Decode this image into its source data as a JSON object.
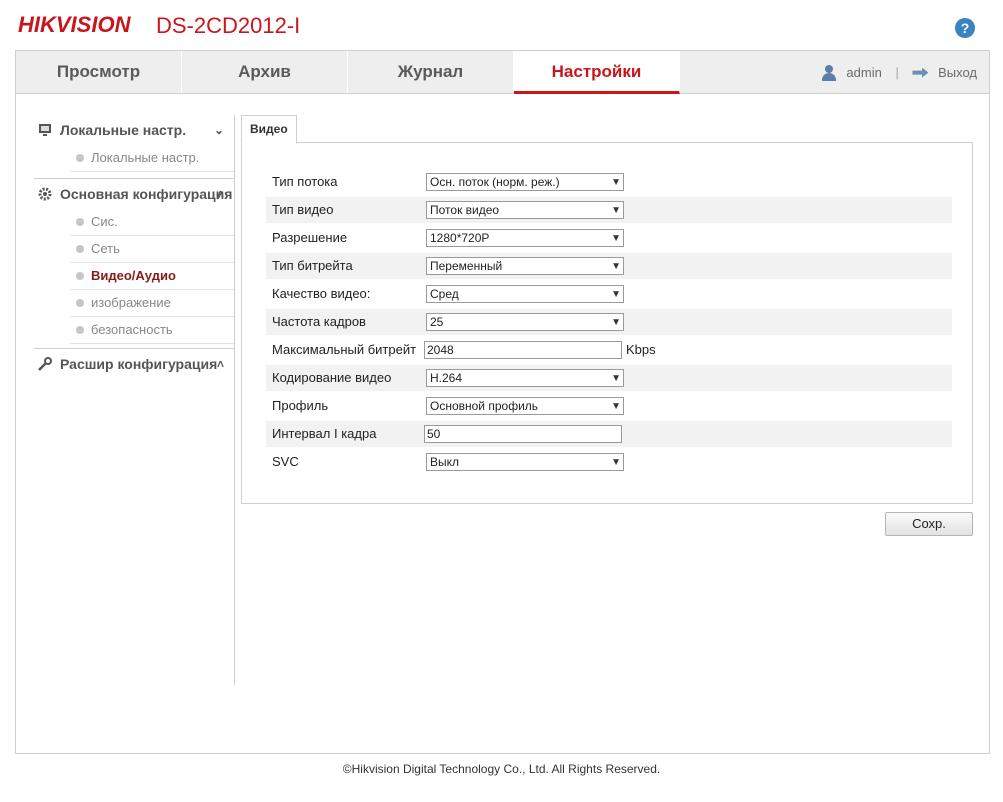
{
  "header": {
    "logo": "HIKVISION",
    "model": "DS-2CD2012-I",
    "help_symbol": "?"
  },
  "nav": {
    "tabs": [
      {
        "label": "Просмотр"
      },
      {
        "label": "Архив"
      },
      {
        "label": "Журнал"
      },
      {
        "label": "Настройки",
        "active": true
      }
    ],
    "user": "admin",
    "separator": "|",
    "logout": "Выход"
  },
  "sidebar": {
    "sections": [
      {
        "label": "Локальные настр.",
        "icon": "monitor-icon",
        "chevron": "⌄",
        "items": [
          {
            "label": "Локальные настр."
          }
        ]
      },
      {
        "label": "Основная конфигурация",
        "icon": "gear-icon",
        "chevron": "˄",
        "items": [
          {
            "label": "Сис."
          },
          {
            "label": "Сеть"
          },
          {
            "label": "Видео/Аудио",
            "active": true
          },
          {
            "label": "изображение"
          },
          {
            "label": "безопасность"
          }
        ]
      },
      {
        "label": "Расшир конфигурация",
        "icon": "wrench-icon",
        "chevron": "˄",
        "items": []
      }
    ]
  },
  "video": {
    "tab_label": "Видео",
    "fields": [
      {
        "label": "Тип потока",
        "value": "Осн. поток (норм. реж.)",
        "type": "select"
      },
      {
        "label": "Тип видео",
        "value": "Поток видео",
        "type": "select"
      },
      {
        "label": "Разрешение",
        "value": "1280*720P",
        "type": "select"
      },
      {
        "label": "Тип битрейта",
        "value": "Переменный",
        "type": "select"
      },
      {
        "label": "Качество видео:",
        "value": "Сред",
        "type": "select"
      },
      {
        "label": "Частота кадров",
        "value": "25",
        "type": "select"
      },
      {
        "label": "Максимальный битрейт",
        "value": "2048",
        "type": "input",
        "unit": "Kbps"
      },
      {
        "label": "Кодирование видео",
        "value": "H.264",
        "type": "select"
      },
      {
        "label": "Профиль",
        "value": "Основной профиль",
        "type": "select"
      },
      {
        "label": "Интервал I кадра",
        "value": "50",
        "type": "input"
      },
      {
        "label": "SVC",
        "value": "Выкл",
        "type": "select"
      }
    ],
    "save_label": "Сохр."
  },
  "footer": {
    "copyright": "©Hikvision Digital Technology Co., Ltd. All Rights Reserved."
  },
  "colors": {
    "brand": "#c8161d"
  }
}
